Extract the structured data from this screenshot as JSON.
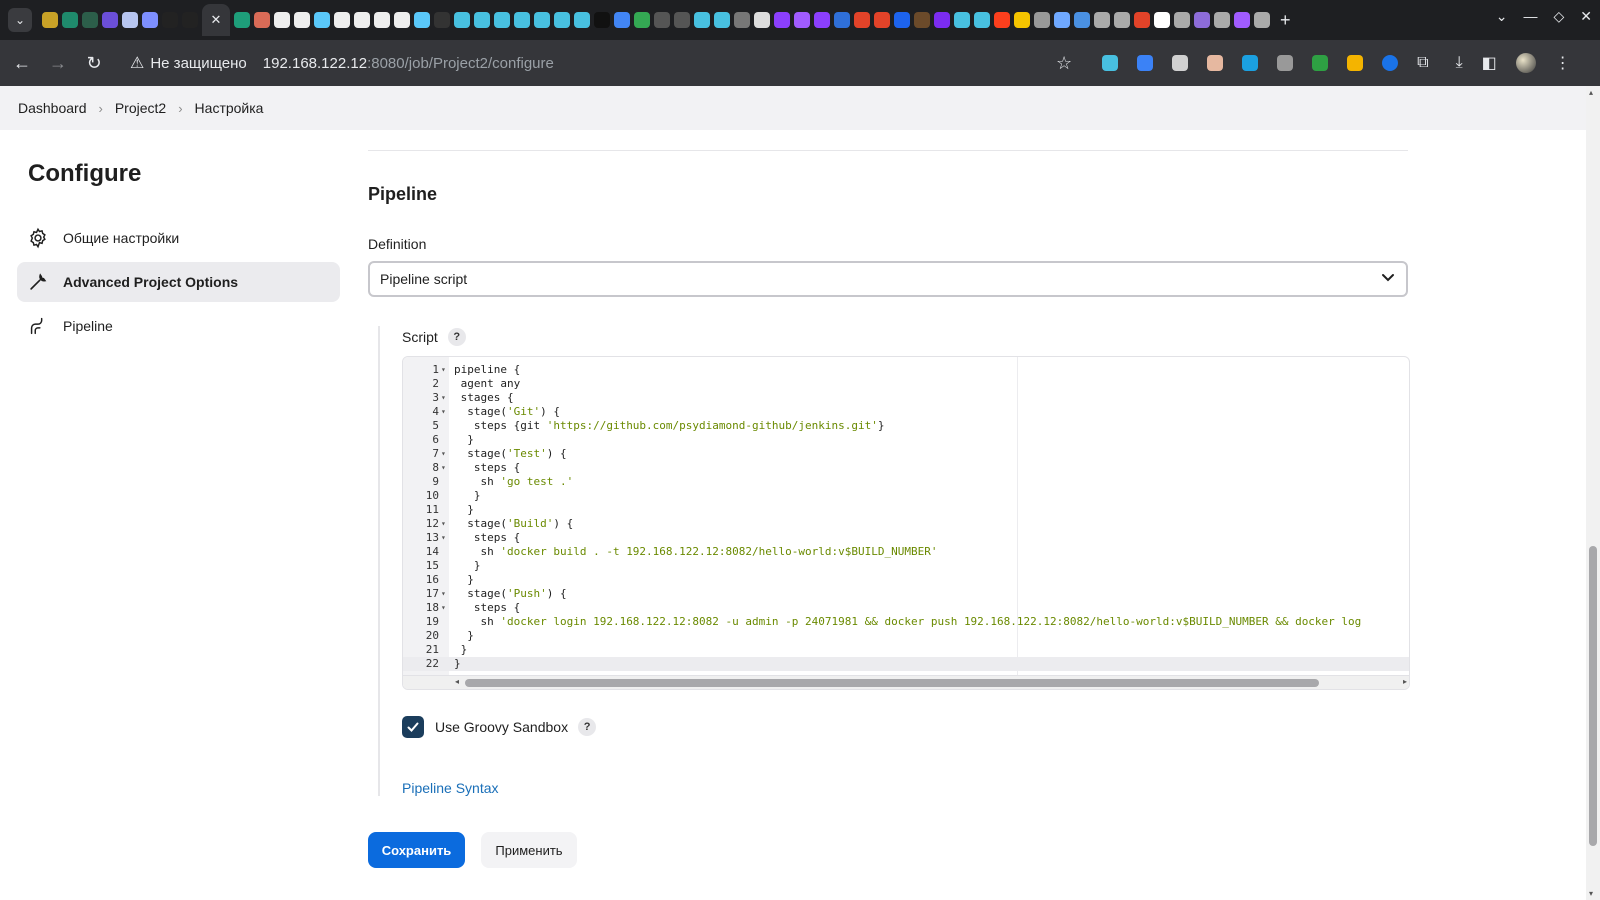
{
  "browser": {
    "active_tab_close": "✕",
    "new_tab": "+",
    "url_warning": "Не защищено",
    "url_host": "192.168.122.12",
    "url_path": ":8080/job/Project2/configure"
  },
  "breadcrumb": [
    "Dashboard",
    "Project2",
    "Настройка"
  ],
  "sidebar": {
    "title": "Configure",
    "items": [
      {
        "label": "Общие настройки",
        "icon": "gear-icon"
      },
      {
        "label": "Advanced Project Options",
        "icon": "wrench-icon"
      },
      {
        "label": "Pipeline",
        "icon": "pipeline-icon"
      }
    ]
  },
  "main": {
    "section_title": "Pipeline",
    "definition_label": "Definition",
    "definition_value": "Pipeline script",
    "script_label": "Script",
    "help_glyph": "?",
    "sandbox_label": "Use Groovy Sandbox",
    "sandbox_checked": true,
    "syntax_link": "Pipeline Syntax"
  },
  "code": {
    "lines": [
      {
        "n": "1",
        "fold": true,
        "text": "pipeline {"
      },
      {
        "n": "2",
        "fold": false,
        "text": " agent any"
      },
      {
        "n": "3",
        "fold": true,
        "text": " stages {"
      },
      {
        "n": "4",
        "fold": true,
        "text": "  stage('Git') {"
      },
      {
        "n": "5",
        "fold": false,
        "text": "   steps {git 'https://github.com/psydiamond-github/jenkins.git'}"
      },
      {
        "n": "6",
        "fold": false,
        "text": "  }"
      },
      {
        "n": "7",
        "fold": true,
        "text": "  stage('Test') {"
      },
      {
        "n": "8",
        "fold": true,
        "text": "   steps {"
      },
      {
        "n": "9",
        "fold": false,
        "text": "    sh 'go test .'"
      },
      {
        "n": "10",
        "fold": false,
        "text": "   }"
      },
      {
        "n": "11",
        "fold": false,
        "text": "  }"
      },
      {
        "n": "12",
        "fold": true,
        "text": "  stage('Build') {"
      },
      {
        "n": "13",
        "fold": true,
        "text": "   steps {"
      },
      {
        "n": "14",
        "fold": false,
        "text": "    sh 'docker build . -t 192.168.122.12:8082/hello-world:v$BUILD_NUMBER'"
      },
      {
        "n": "15",
        "fold": false,
        "text": "   }"
      },
      {
        "n": "16",
        "fold": false,
        "text": "  }"
      },
      {
        "n": "17",
        "fold": true,
        "text": "  stage('Push') {"
      },
      {
        "n": "18",
        "fold": true,
        "text": "   steps {"
      },
      {
        "n": "19",
        "fold": false,
        "text": "    sh 'docker login 192.168.122.12:8082 -u admin -p 24071981 && docker push 192.168.122.12:8082/hello-world:v$BUILD_NUMBER && docker log"
      },
      {
        "n": "20",
        "fold": false,
        "text": "  }"
      },
      {
        "n": "21",
        "fold": false,
        "text": " }"
      },
      {
        "n": "22",
        "fold": false,
        "text": "}"
      }
    ],
    "active_line": 22
  },
  "actions": {
    "save": "Сохранить",
    "apply": "Применить"
  },
  "colors": {
    "primary": "#0b6bde",
    "link": "#1a6fb8",
    "checkbox": "#1b3d5c",
    "string": "#6a8a00"
  }
}
